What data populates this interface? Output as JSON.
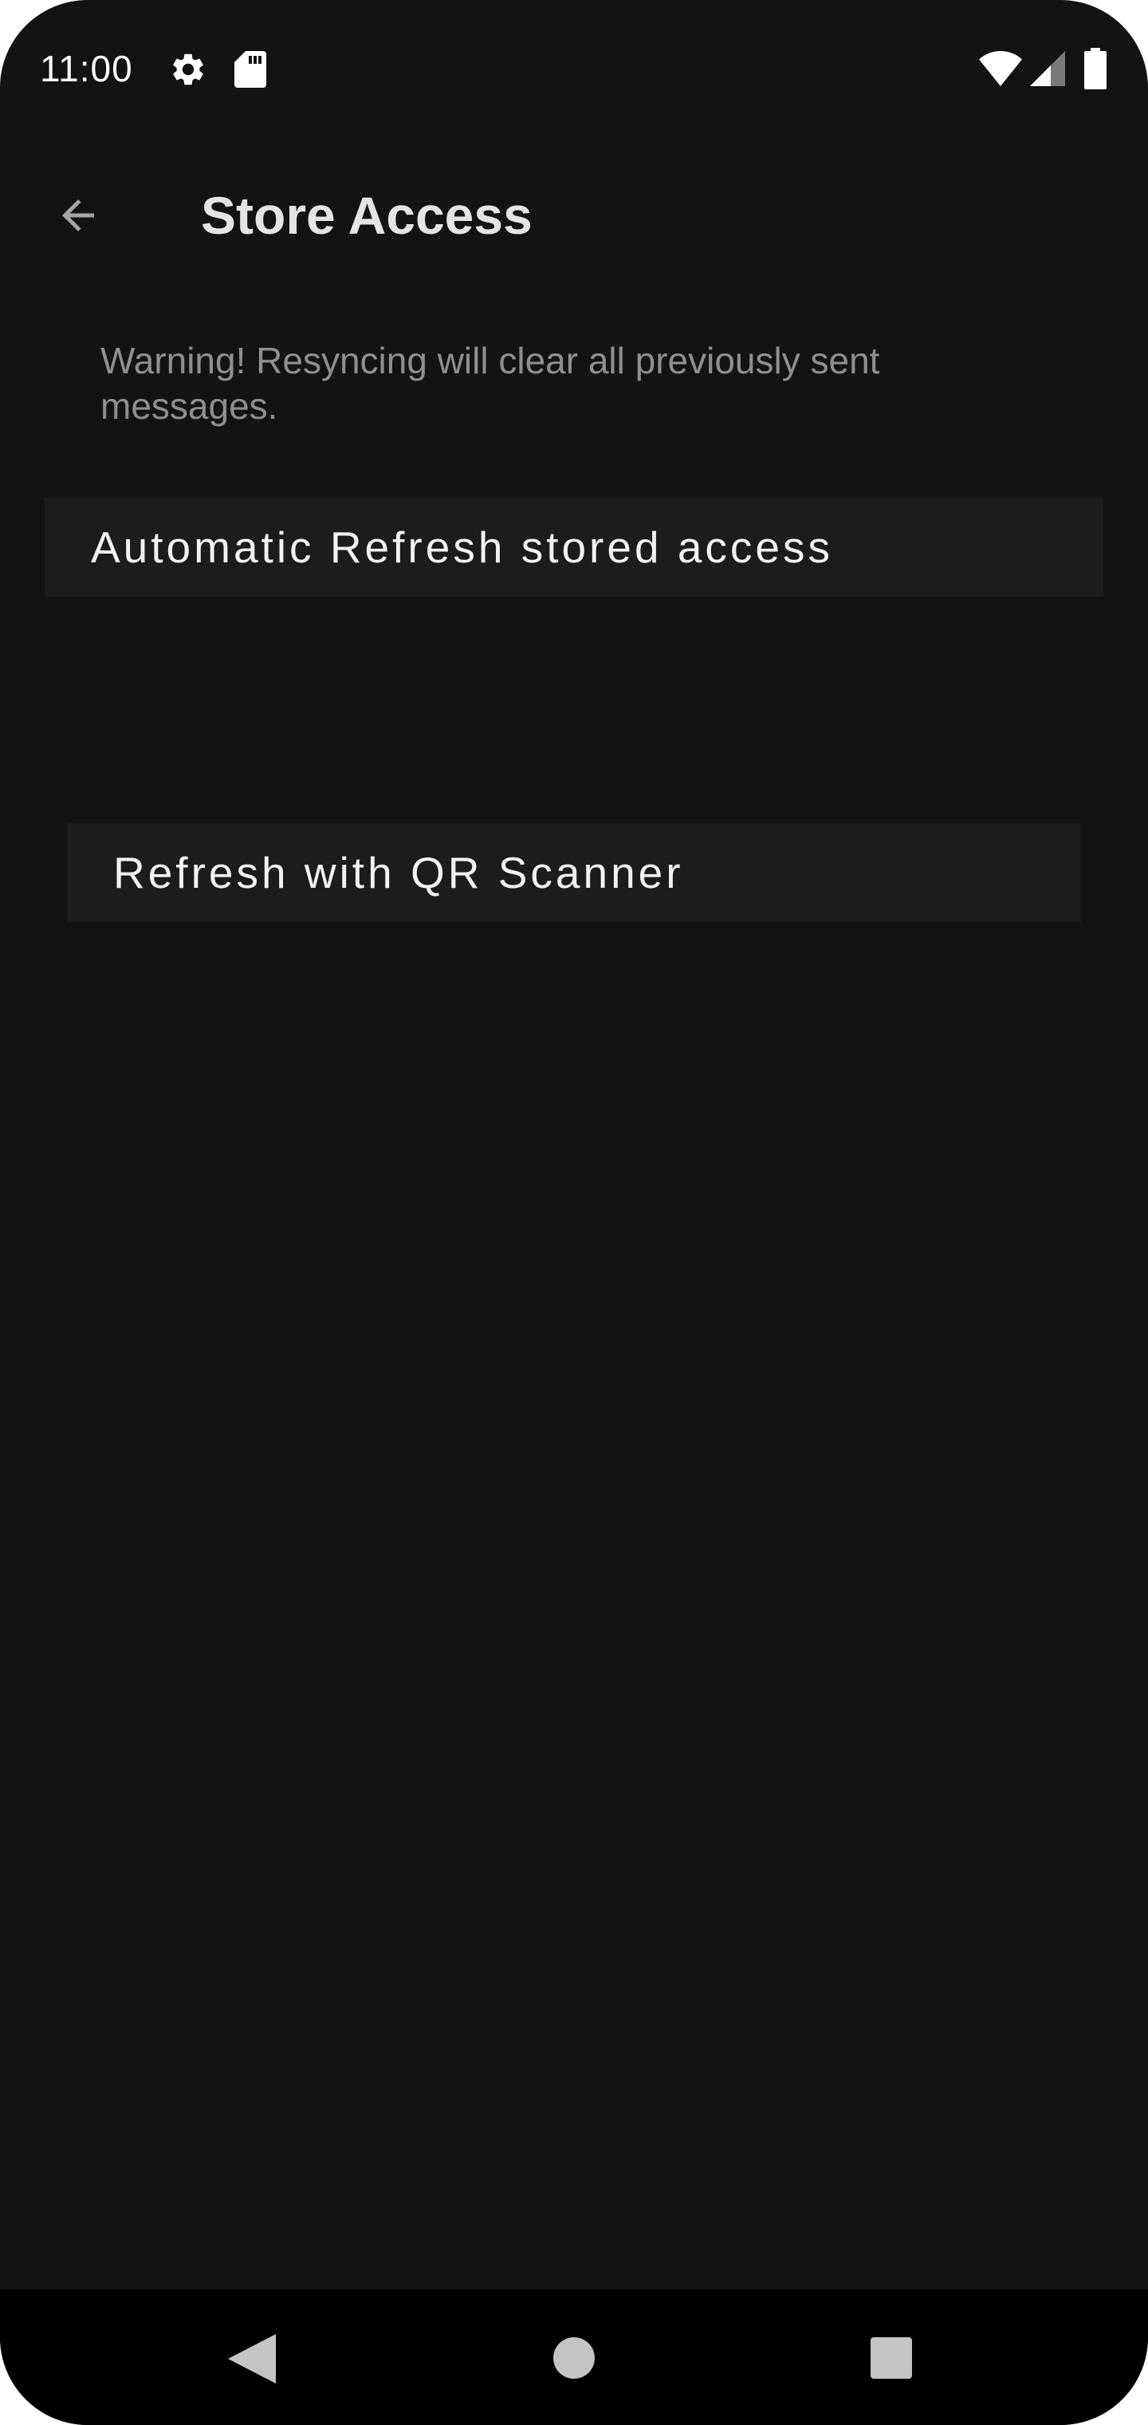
{
  "status_bar": {
    "time": "11:00",
    "icons": [
      "gear-icon",
      "sd-card-icon",
      "wifi-icon",
      "signal-icon",
      "battery-icon"
    ]
  },
  "toolbar": {
    "back_icon": "arrow-left-icon",
    "title": "Store Access"
  },
  "content": {
    "warning": "Warning! Resyncing will clear all previously sent messages.",
    "auto_refresh_label": "Automatic Refresh stored access",
    "qr_refresh_label": "Refresh with QR Scanner"
  },
  "nav_bar": {
    "icons": [
      "nav-back-icon",
      "nav-home-icon",
      "nav-recents-icon"
    ]
  },
  "colors": {
    "background": "#131313",
    "button_background": "#1c1c1c",
    "title_text": "#e4e4e4",
    "warning_text": "#8f8f8f",
    "button_text": "#f2f2f2",
    "nav_bar": "#000000"
  }
}
